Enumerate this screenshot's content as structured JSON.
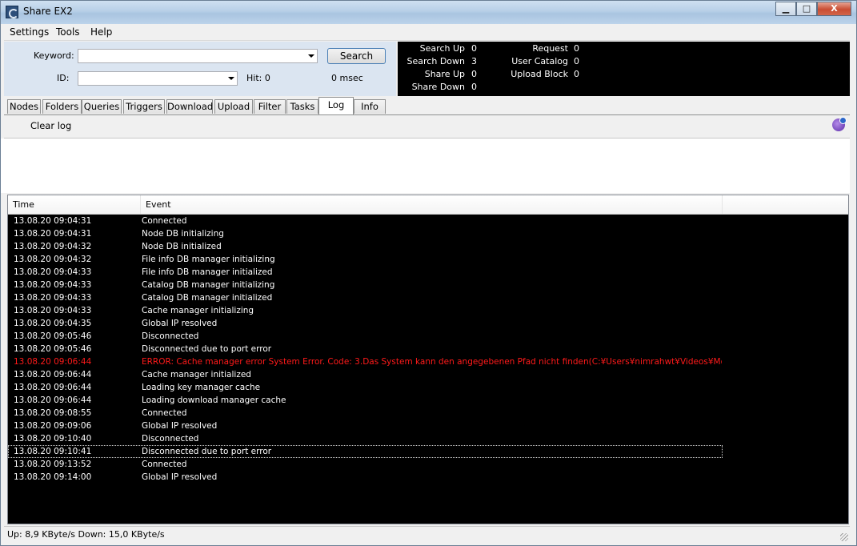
{
  "window": {
    "title": "Share EX2"
  },
  "controls": {
    "minimize": "▁",
    "maximize": "□",
    "close": "X"
  },
  "menu": {
    "items": [
      "Settings",
      "Tools",
      "Help"
    ]
  },
  "search": {
    "keyword_label": "Keyword:",
    "keyword_value": "",
    "id_label": "ID:",
    "id_value": "",
    "search_button": "Search",
    "hit": "Hit: 0",
    "time": "0 msec"
  },
  "stats": {
    "left": [
      {
        "label": "Search Up",
        "value": "0"
      },
      {
        "label": "Search Down",
        "value": "3"
      },
      {
        "label": "Share Up",
        "value": "0"
      },
      {
        "label": "Share Down",
        "value": "0"
      }
    ],
    "right": [
      {
        "label": "Request",
        "value": "0"
      },
      {
        "label": "User Catalog",
        "value": "0"
      },
      {
        "label": "Upload Block",
        "value": "0"
      }
    ]
  },
  "tabs": [
    "Nodes",
    "Folders",
    "Queries",
    "Triggers",
    "Download",
    "Upload",
    "Filter",
    "Tasks",
    "Log",
    "Info"
  ],
  "active_tab": "Log",
  "log_toolbar": {
    "clear": "Clear log",
    "icon": "user-icon"
  },
  "log": {
    "columns": [
      "Time",
      "Event"
    ],
    "rows": [
      {
        "time": "13.08.20 09:04:31",
        "event": "Connected"
      },
      {
        "time": "13.08.20 09:04:31",
        "event": "Node DB initializing"
      },
      {
        "time": "13.08.20 09:04:32",
        "event": "Node DB initialized"
      },
      {
        "time": "13.08.20 09:04:32",
        "event": "File info DB manager initializing"
      },
      {
        "time": "13.08.20 09:04:33",
        "event": "File info DB manager initialized"
      },
      {
        "time": "13.08.20 09:04:33",
        "event": "Catalog DB manager initializing"
      },
      {
        "time": "13.08.20 09:04:33",
        "event": "Catalog DB manager initialized"
      },
      {
        "time": "13.08.20 09:04:33",
        "event": "Cache manager initializing"
      },
      {
        "time": "13.08.20 09:04:35",
        "event": "Global IP resolved"
      },
      {
        "time": "13.08.20 09:05:46",
        "event": "Disconnected"
      },
      {
        "time": "13.08.20 09:05:46",
        "event": "Disconnected due to port error"
      },
      {
        "time": "13.08.20 09:06:44",
        "event": "ERROR: Cache manager error System Error.  Code: 3.Das System kann den angegebenen Pfad nicht finden(C:¥Users¥nimrahwt¥Videos¥Morni"
      },
      {
        "time": "13.08.20 09:06:44",
        "event": "Cache manager initialized"
      },
      {
        "time": "13.08.20 09:06:44",
        "event": "Loading key manager cache"
      },
      {
        "time": "13.08.20 09:06:44",
        "event": "Loading download manager cache"
      },
      {
        "time": "13.08.20 09:08:55",
        "event": "Connected"
      },
      {
        "time": "13.08.20 09:09:06",
        "event": "Global IP resolved"
      },
      {
        "time": "13.08.20 09:10:40",
        "event": "Disconnected"
      },
      {
        "time": "13.08.20 09:10:41",
        "event": "Disconnected due to port error"
      },
      {
        "time": "13.08.20 09:13:52",
        "event": "Connected"
      },
      {
        "time": "13.08.20 09:14:00",
        "event": "Global IP resolved"
      }
    ],
    "error_color": "#ff1a1a"
  },
  "status": {
    "text": "Up: 8,9 KByte/s Down: 15,0 KByte/s"
  }
}
